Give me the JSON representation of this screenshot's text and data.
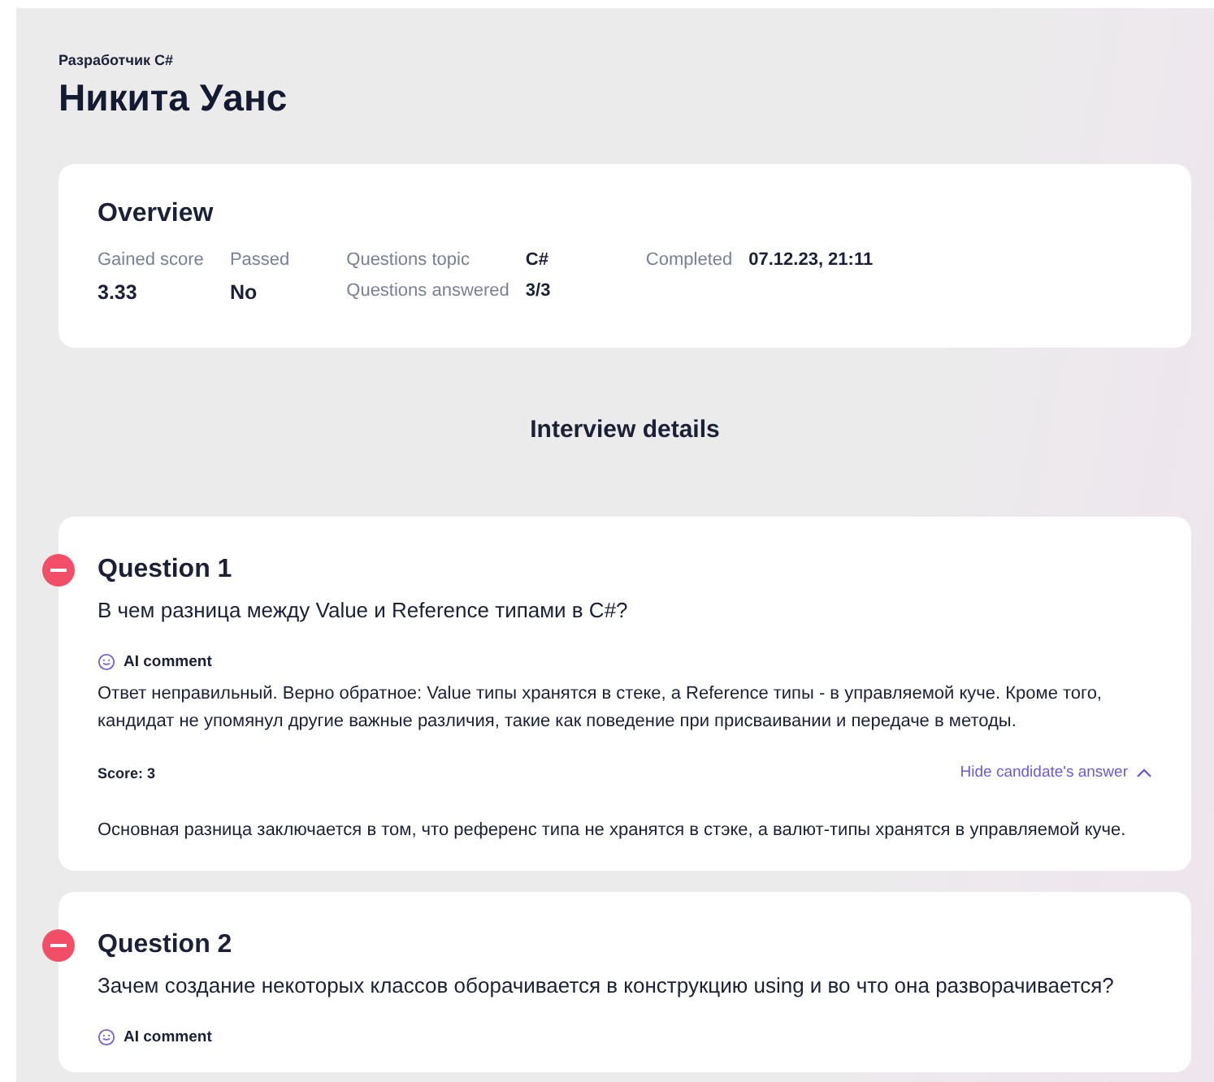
{
  "header": {
    "subtitle": "Разработчик C#",
    "name": "Никита Уанс"
  },
  "overview": {
    "title": "Overview",
    "stats": [
      {
        "label": "Gained score",
        "value": "3.33"
      },
      {
        "label": "Passed",
        "value": "No"
      }
    ],
    "details": [
      {
        "label": "Questions topic",
        "value": "C#"
      },
      {
        "label": "Completed",
        "value": "07.12.23, 21:11"
      },
      {
        "label": "Questions answered",
        "value": "3/3"
      }
    ]
  },
  "section_title": "Interview details",
  "questions": [
    {
      "title": "Question 1",
      "correct": false,
      "text": "В чем разница между Value и Reference типами в C#?",
      "comment_label": "AI comment",
      "comment": "Ответ неправильный. Верно обратное: Value типы хранятся в стеке, а Reference типы - в управляемой куче. Кроме того, кандидат не упомянул другие важные различия, такие как поведение при присваивании и передаче в методы.",
      "score": "Score: 3",
      "toggle": "Hide candidate's answer",
      "expanded": true,
      "answer": "Основная разница заключается в том, что референс типа не хранятся в стэке, а валют-типы хранятся в управляемой куче."
    },
    {
      "title": "Question 2",
      "correct": false,
      "text": "Зачем создание некоторых классов оборачивается в конструкцию using и во что она разворачивается?",
      "comment_label": "AI comment"
    }
  ]
}
